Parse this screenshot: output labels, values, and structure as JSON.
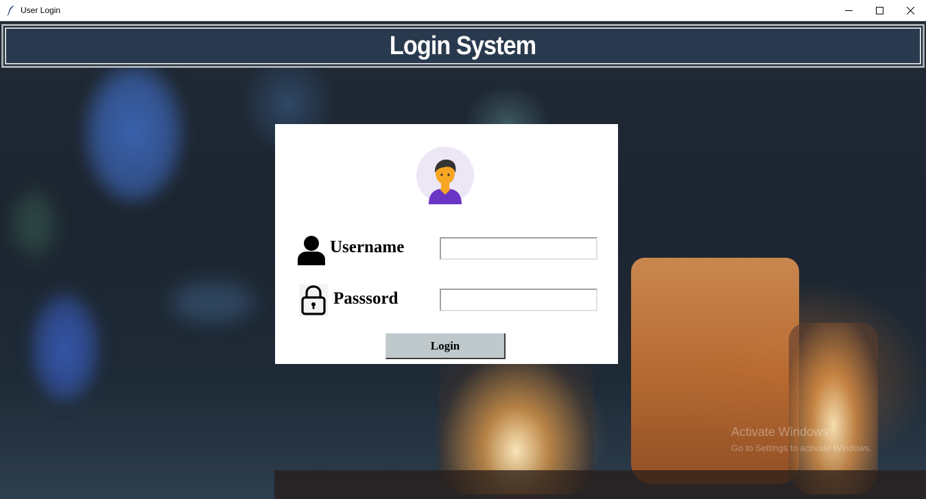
{
  "window": {
    "title": "User Login",
    "controls": {
      "minimize_icon": "minimize-icon",
      "maximize_icon": "maximize-icon",
      "close_icon": "close-icon"
    }
  },
  "header": {
    "title": "Login System",
    "background_color": "#2a3a4e"
  },
  "login_form": {
    "avatar_icon": "user-avatar-icon",
    "username": {
      "icon": "user-icon",
      "label": "Username",
      "value": ""
    },
    "password": {
      "icon": "lock-icon",
      "label": "Passsord",
      "value": ""
    },
    "submit_label": "Login",
    "submit_color": "#bfc9cb"
  },
  "watermark": {
    "title": "Activate Windows",
    "subtitle": "Go to Settings to activate Windows."
  }
}
